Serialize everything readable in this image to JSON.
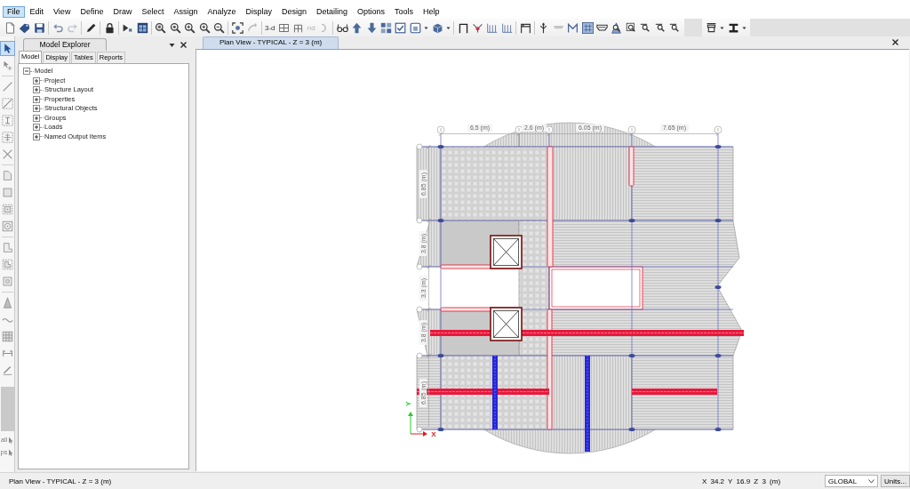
{
  "menu": [
    {
      "label": "File",
      "selected": true
    },
    {
      "label": "Edit",
      "selected": false
    },
    {
      "label": "View",
      "selected": false
    },
    {
      "label": "Define",
      "selected": false
    },
    {
      "label": "Draw",
      "selected": false
    },
    {
      "label": "Select",
      "selected": false
    },
    {
      "label": "Assign",
      "selected": false
    },
    {
      "label": "Analyze",
      "selected": false
    },
    {
      "label": "Display",
      "selected": false
    },
    {
      "label": "Design",
      "selected": false
    },
    {
      "label": "Detailing",
      "selected": false
    },
    {
      "label": "Options",
      "selected": false
    },
    {
      "label": "Tools",
      "selected": false
    },
    {
      "label": "Help",
      "selected": false
    }
  ],
  "toolbar": [
    {
      "label": "3-d",
      "disabled": false
    },
    {
      "label": "nd",
      "disabled": true
    }
  ],
  "draw_toolbar": {
    "tools": [
      {
        "selected": true
      },
      {
        "selected": false
      },
      {
        "selected": false
      },
      {
        "selected": false
      },
      {
        "selected": false
      },
      {
        "selected": false
      },
      {
        "selected": false
      },
      {
        "selected": false
      },
      {
        "selected": false
      },
      {
        "selected": false
      },
      {
        "selected": false
      },
      {
        "selected": false
      },
      {
        "selected": false
      },
      {
        "selected": false
      },
      {
        "selected": false
      },
      {
        "selected": false
      },
      {
        "selected": false
      },
      {
        "selected": false
      },
      {
        "selected": false
      }
    ],
    "selection_buttons": [
      "all",
      "ps"
    ]
  },
  "explorer": {
    "title": "Model Explorer",
    "tabs": [
      {
        "label": "Model",
        "selected": true
      },
      {
        "label": "Display",
        "selected": false
      },
      {
        "label": "Tables",
        "selected": false
      },
      {
        "label": "Reports",
        "selected": false
      }
    ],
    "tree": [
      {
        "label": "Model",
        "expanded": true,
        "children": [
          {
            "label": "Project",
            "expanded": false
          },
          {
            "label": "Structure Layout",
            "expanded": false
          },
          {
            "label": "Properties",
            "expanded": false
          },
          {
            "label": "Structural Objects",
            "expanded": false
          },
          {
            "label": "Groups",
            "expanded": false
          },
          {
            "label": "Loads",
            "expanded": false
          },
          {
            "label": "Named Output Items",
            "expanded": false
          }
        ]
      }
    ]
  },
  "document_tabs": [
    {
      "label": "Plan View - TYPICAL - Z = 3 (m)",
      "selected": true
    }
  ],
  "plan": {
    "column_dimensions": [
      "6.5 (m)",
      "2.6 (m)",
      "6.05 (m)",
      "7.65 (m)"
    ],
    "row_dimensions": [
      "6.85 (m)",
      "3.8 (m)",
      "3.3 (m)",
      "3.8 (m)",
      "6.85 (m)"
    ],
    "axis_labels": [
      "X",
      "Y"
    ]
  },
  "status_bar": {
    "view": "Plan View - TYPICAL - Z = 3 (m)",
    "coordinates": "X 34.2 Y 16.9 Z 3 (m)",
    "coordinate_system": "GLOBAL",
    "units_button": "Units..."
  }
}
